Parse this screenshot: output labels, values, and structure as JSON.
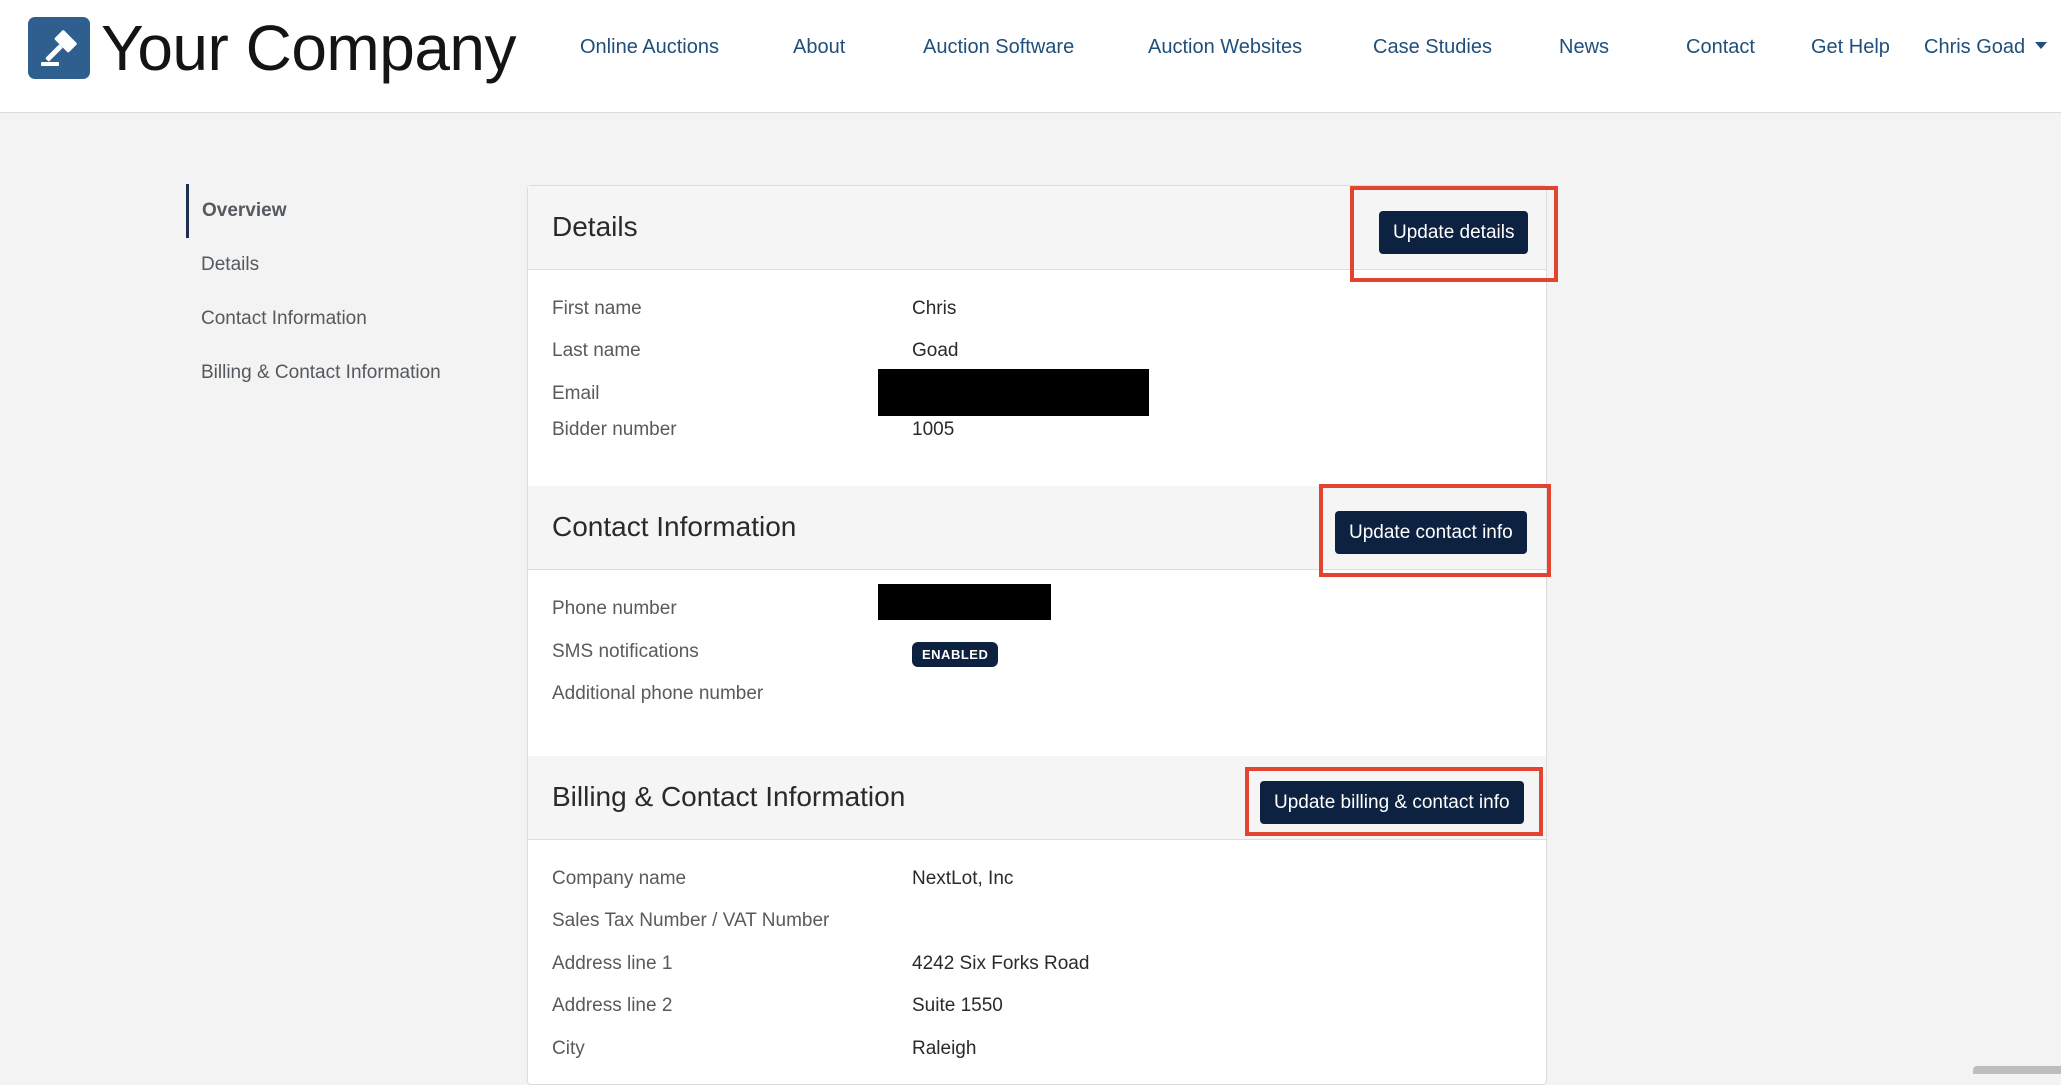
{
  "header": {
    "logo_text": "Your Company",
    "nav": [
      "Online Auctions",
      "About",
      "Auction Software",
      "Auction Websites",
      "Case Studies",
      "News",
      "Contact",
      "Get Help"
    ],
    "user_menu": "Chris Goad"
  },
  "sidebar": {
    "items": [
      "Overview",
      "Details",
      "Contact Information",
      "Billing & Contact Information"
    ],
    "active_index": 0
  },
  "details": {
    "title": "Details",
    "button": "Update details",
    "rows": [
      {
        "label": "First name",
        "value": "Chris"
      },
      {
        "label": "Last name",
        "value": "Goad"
      },
      {
        "label": "Email",
        "value": ""
      },
      {
        "label": "Bidder number",
        "value": "1005"
      }
    ]
  },
  "contact": {
    "title": "Contact Information",
    "button": "Update contact info",
    "rows": [
      {
        "label": "Phone number",
        "value": ""
      },
      {
        "label": "SMS notifications",
        "value": "ENABLED"
      },
      {
        "label": "Additional phone number",
        "value": ""
      }
    ]
  },
  "billing": {
    "title": "Billing & Contact Information",
    "button": "Update billing & contact info",
    "rows": [
      {
        "label": "Company name",
        "value": "NextLot, Inc"
      },
      {
        "label": "Sales Tax Number / VAT Number",
        "value": ""
      },
      {
        "label": "Address line 1",
        "value": "4242 Six Forks Road"
      },
      {
        "label": "Address line 2",
        "value": "Suite 1550"
      },
      {
        "label": "City",
        "value": "Raleigh"
      }
    ]
  },
  "colors": {
    "accent": "#0c2240",
    "link": "#1f4f7a",
    "highlight": "#e2442f",
    "logo": "#2f5f8f"
  }
}
